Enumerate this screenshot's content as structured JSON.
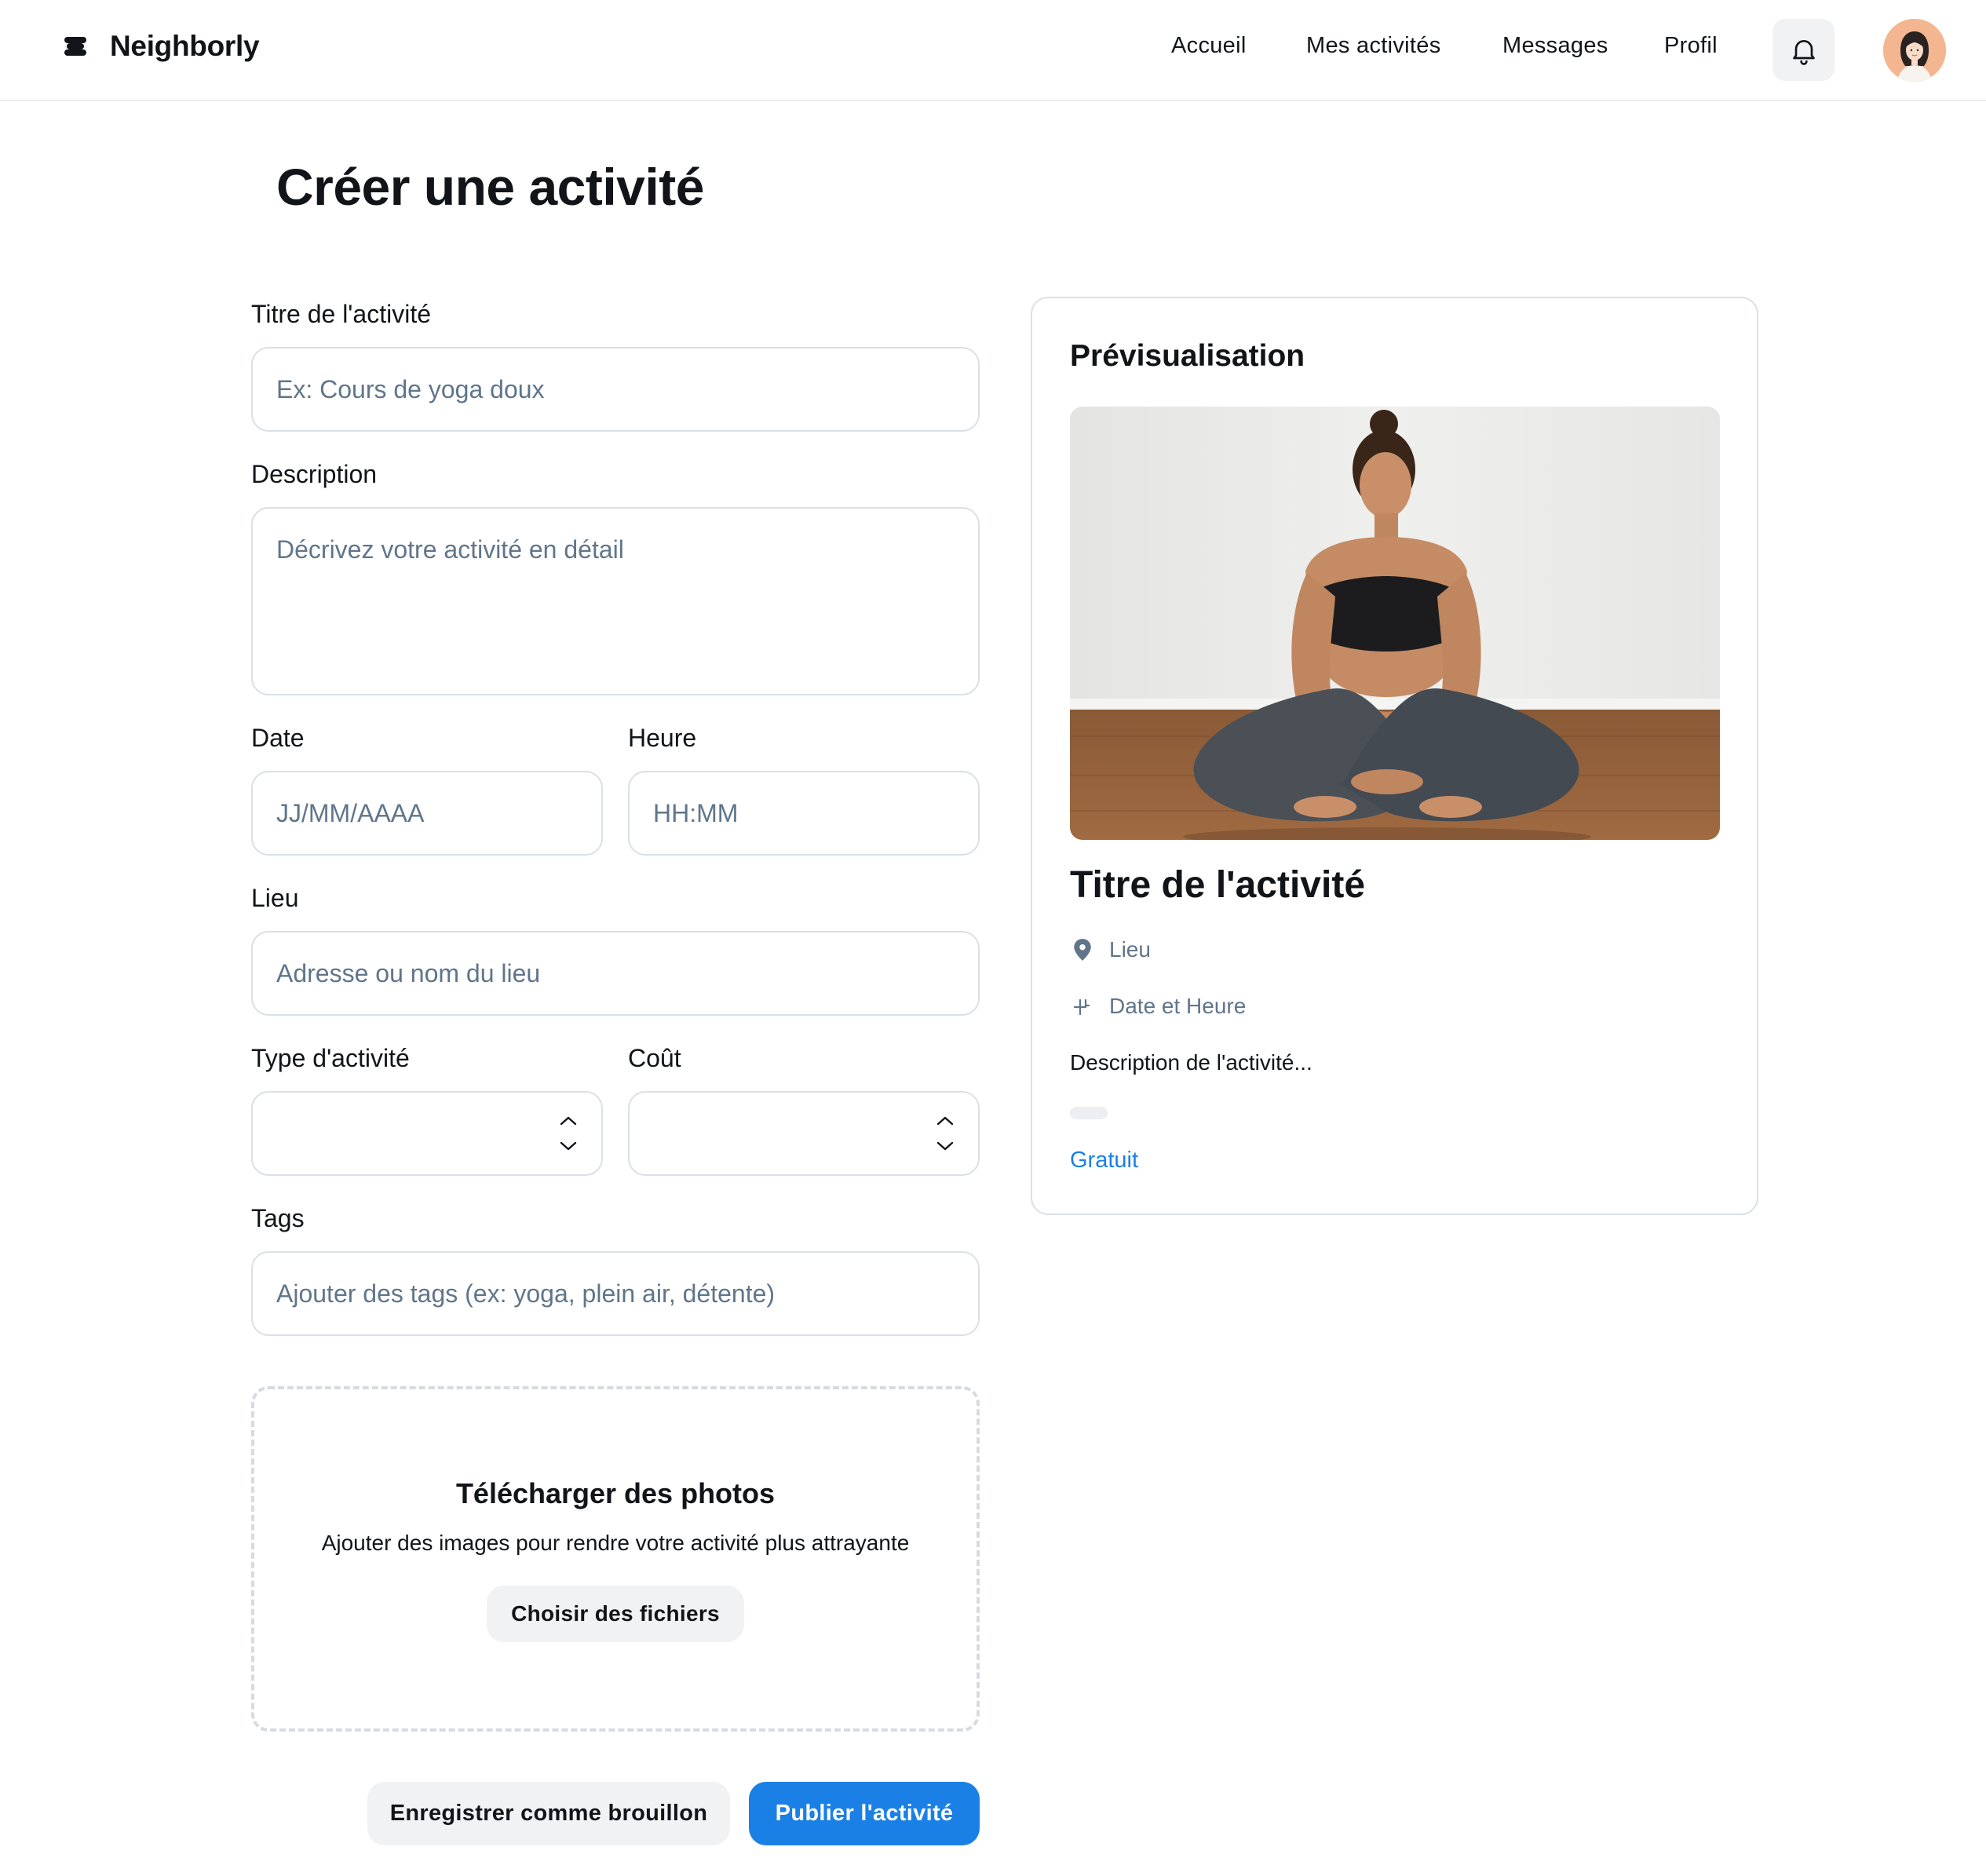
{
  "header": {
    "brand": "Neighborly",
    "nav": [
      "Accueil",
      "Mes activités",
      "Messages",
      "Profil"
    ]
  },
  "page": {
    "title": "Créer une activité"
  },
  "form": {
    "title_label": "Titre de l'activité",
    "title_placeholder": "Ex: Cours de yoga doux",
    "description_label": "Description",
    "description_placeholder": "Décrivez votre activité en détail",
    "date_label": "Date",
    "date_placeholder": "JJ/MM/AAAA",
    "time_label": "Heure",
    "time_placeholder": "HH:MM",
    "location_label": "Lieu",
    "location_placeholder": "Adresse ou nom du lieu",
    "type_label": "Type d'activité",
    "type_value": "",
    "cost_label": "Coût",
    "cost_value": "",
    "tags_label": "Tags",
    "tags_placeholder": "Ajouter des tags (ex: yoga, plein air, détente)"
  },
  "upload": {
    "title": "Télécharger des photos",
    "subtitle": "Ajouter des images pour rendre votre activité plus attrayante",
    "button": "Choisir des fichiers"
  },
  "actions": {
    "draft": "Enregistrer comme brouillon",
    "publish": "Publier l'activité"
  },
  "preview": {
    "heading": "Prévisualisation",
    "title": "Titre de l'activité",
    "location": "Lieu",
    "datetime": "Date et Heure",
    "description": "Description de l'activité...",
    "price": "Gratuit"
  },
  "colors": {
    "primary": "#1a80e5",
    "text": "#111418",
    "muted": "#60758a",
    "border": "#dbe0e6",
    "button_bg": "#f0f2f4"
  },
  "icons": {
    "brand": "brand-logo-icon",
    "notifications": "bell-icon",
    "location": "map-pin-icon",
    "datetime": "calendar-clock-icon",
    "select": "chevron-up-down-icon"
  }
}
